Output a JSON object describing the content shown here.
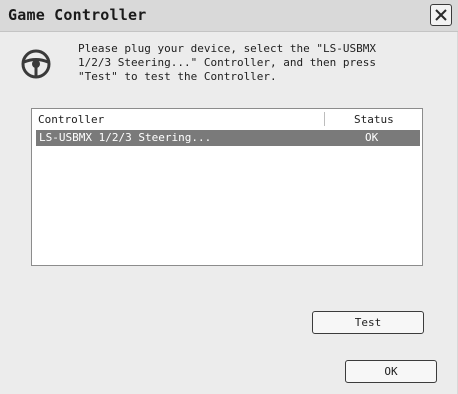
{
  "window": {
    "title": "Game Controller",
    "close_icon": "close-icon"
  },
  "instructions": {
    "icon": "steering-wheel-icon",
    "text": "Please plug your device, select the \"LS-USBMX\n1/2/3 Steering...\" Controller, and then press\n\"Test\" to test the Controller."
  },
  "controller_list": {
    "columns": [
      "Controller",
      "Status"
    ],
    "rows": [
      {
        "controller": "LS-USBMX 1/2/3 Steering...",
        "status": "OK",
        "selected": true
      }
    ]
  },
  "buttons": {
    "test_label": "Test",
    "ok_label": "OK"
  },
  "colors": {
    "selection_bg": "#7a7a7a",
    "window_bg": "#ececec"
  }
}
